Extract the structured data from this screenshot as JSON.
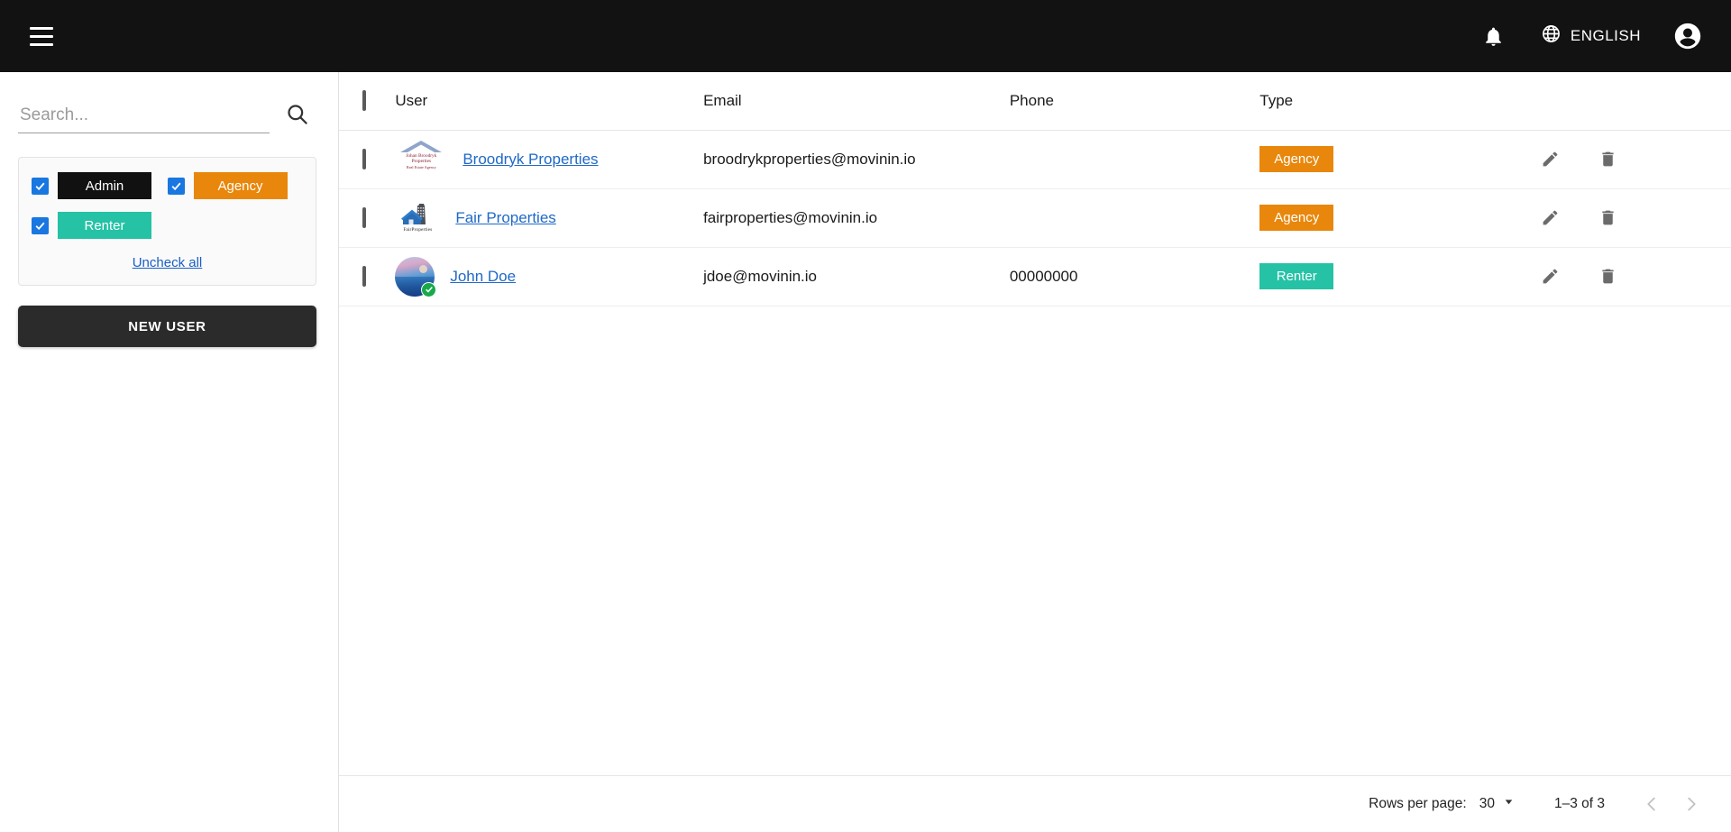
{
  "header": {
    "menu_icon": "hamburger-menu-icon",
    "notifications_icon": "bell-icon",
    "language_icon": "globe-icon",
    "language_label": "ENGLISH",
    "account_icon": "account-circle-icon",
    "background_color": "#121212"
  },
  "sidebar": {
    "search": {
      "placeholder": "Search...",
      "value": "",
      "icon": "search-icon"
    },
    "filters": {
      "items": [
        {
          "label": "Admin",
          "checked": true,
          "color": "#111111"
        },
        {
          "label": "Agency",
          "checked": true,
          "color": "#e8870b"
        },
        {
          "label": "Renter",
          "checked": true,
          "color": "#25c2a6"
        }
      ],
      "uncheck_all_label": "Uncheck all"
    },
    "new_user_label": "NEW USER"
  },
  "table": {
    "select_all_checked": false,
    "columns": [
      "User",
      "Email",
      "Phone",
      "Type"
    ],
    "rows": [
      {
        "checked": false,
        "avatar_type": "logo-broodryk",
        "avatar_text_line1": "Johan Broodryk",
        "avatar_text_line2": "Properties",
        "avatar_text_line3": "Real Estate Agency",
        "user": "Broodryk Properties",
        "email": "broodrykproperties@movinin.io",
        "phone": "",
        "type": "Agency",
        "type_color": "#e8870b",
        "verified": false
      },
      {
        "checked": false,
        "avatar_type": "logo-fair",
        "avatar_text_line1": "FairProperties",
        "user": "Fair Properties",
        "email": "fairproperties@movinin.io",
        "phone": "",
        "type": "Agency",
        "type_color": "#e8870b",
        "verified": false
      },
      {
        "checked": false,
        "avatar_type": "photo",
        "user": "John Doe",
        "email": "jdoe@movinin.io",
        "phone": "00000000",
        "type": "Renter",
        "type_color": "#25c2a6",
        "verified": true
      }
    ],
    "row_actions": {
      "edit_icon": "pencil-icon",
      "delete_icon": "trash-icon"
    }
  },
  "pagination": {
    "rows_per_page_label": "Rows per page:",
    "rows_per_page_value": "30",
    "range_label": "1–3 of 3",
    "prev_icon": "chevron-left-icon",
    "next_icon": "chevron-right-icon"
  }
}
